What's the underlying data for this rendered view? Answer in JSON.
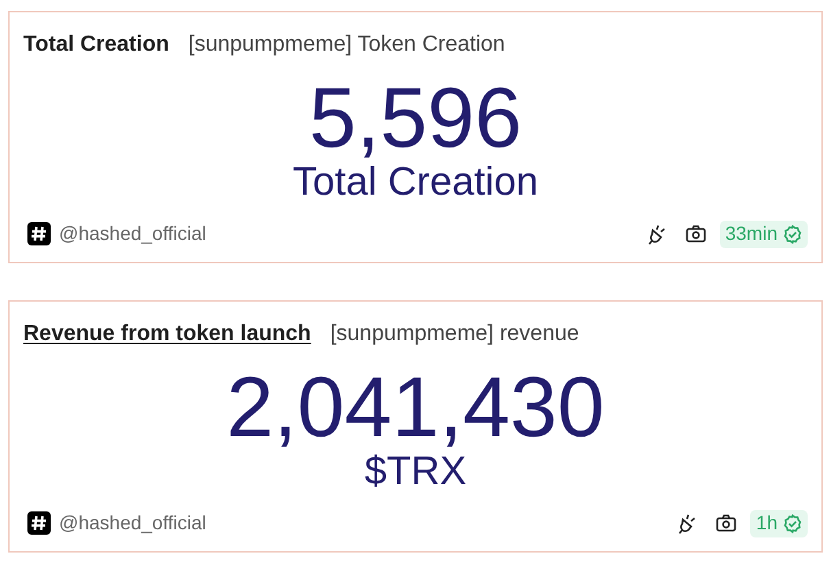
{
  "cards": [
    {
      "title": "Total Creation",
      "title_hovered": false,
      "query": "[sunpumpmeme] Token Creation",
      "value": "5,596",
      "caption": "Total Creation",
      "author": "@hashed_official",
      "freshness": "33min"
    },
    {
      "title": "Revenue from token launch",
      "title_hovered": true,
      "query": "[sunpumpmeme] revenue",
      "value": "2,041,430",
      "caption": "$TRX",
      "author": "@hashed_official",
      "freshness": "1h"
    }
  ]
}
